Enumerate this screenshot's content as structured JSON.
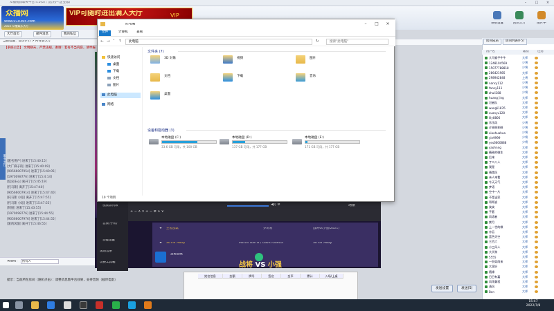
{
  "app": {
    "title": "众播视频聊天平台 4.0(0) 门店用户(企业版)",
    "logo_main": "众播网",
    "logo_url": "www.010365.com",
    "logo_sub": "2022 众播娱乐大厅",
    "vip_banner": "VIP可随时进出满人大厅",
    "vip_badge": "VIP"
  },
  "top_buttons": [
    "系统设置",
    "回到大厅",
    "图片申"
  ],
  "nav": {
    "items": [
      "大厅首页",
      "邮件消息",
      "我的私信"
    ],
    "breadcrumb": "当前位置：首页(F1)  >  所在会大厅",
    "announcement": "【系统公告】 文明聊天，严禁违规，谢谢！若有不当内容，请举报"
  },
  "side_tab": "聊天大厅",
  "chat_lines": [
    "[匿名用户]   进来了[15:40:15]",
    "[大厂麻子的]   进来了[15:40:09]",
    "[90566007954]   进来了[15:40:05]",
    "[1970098776]   进来了[15:4:14]",
    "[炫尖乐心]   离开了[15:45:19]",
    "[托马斯]   离开了[15:47:40]",
    "[90566007914]   进来了[15:47:40]",
    "[托马斯 小段]   离开了[15:47:55]",
    "[托马斯 小段]   进来了[15:47:55]",
    "[阿姐]   进来了[15:43:55]",
    "[1970098776]   进来了[15:44:55]",
    "[90566007976]   进来了[15:44:55]",
    "[爱的风旅]   离开了[15:46:55]"
  ],
  "input": {
    "label": "发送给：",
    "target": "所有人"
  },
  "status_tip": "提示：当前所在房间（随机点击）：调整消息数平台效果，支持音频（截停电影）",
  "buttons": {
    "send_settings": "发送设置",
    "send": "发送(S)"
  },
  "explorer": {
    "title": "此电脑",
    "tabs": [
      "文件",
      "计算机",
      "查看"
    ],
    "address": "此电脑",
    "search_placeholder": "搜索\"此电脑\"",
    "nav": [
      {
        "label": "快速访问",
        "sel": false
      },
      {
        "label": "桌面",
        "sel": false
      },
      {
        "label": "下载",
        "sel": false
      },
      {
        "label": "文档",
        "sel": false
      },
      {
        "label": "图片",
        "sel": false
      },
      {
        "label": "此电脑",
        "sel": true
      },
      {
        "label": "网络",
        "sel": false
      }
    ],
    "folders_header": "文件夹 (7)",
    "folders": [
      "3D 对象",
      "视频",
      "图片",
      "文档",
      "下载",
      "音乐",
      "桌面"
    ],
    "drives_header": "设备和驱动器 (3)",
    "drives": [
      {
        "name": "本地磁盘 (C:)",
        "space": "33.6 GB 可用，共 100 GB",
        "used": 0.66
      },
      {
        "name": "本地磁盘 (D:)",
        "space": "137 GB 可用，共 177 GB",
        "used": 0.23
      },
      {
        "name": "本地磁盘 (E:)",
        "space": "171 GB 可用，共 177 GB",
        "used": 0.04
      }
    ],
    "status": "10 个项目"
  },
  "stream": {
    "obs_sources": [
      "视频源列表",
      "音频(手机)",
      "功能设置",
      "现场音乐",
      "切换工具箱"
    ],
    "obs_scene": "场景",
    "songs": [
      {
        "title": "王者战歌",
        "artist": "罗莉希",
        "extra": "战将vs小强(2021)"
      },
      {
        "title": "So Far Away",
        "artist": "Martin Garrix / David Guetta",
        "extra": "So Far Away"
      }
    ],
    "vs_left": "战将",
    "vs_mid": "VS",
    "vs_right": "小强"
  },
  "sheet_headers": [
    "姓名信息",
    "金额",
    "牌号",
    "签名",
    "金币",
    "累计",
    "入场/上桌"
  ],
  "right_panel": {
    "tabs": [
      "房间成员",
      "房间列表(F5)"
    ],
    "subtab": "用户列表",
    "headers": [
      "用户名",
      "级别",
      "性别"
    ],
    "users": [
      {
        "n": "大马猴子牛牛",
        "r": "大师"
      },
      {
        "n": "1248104569",
        "r": "少将"
      },
      {
        "n": "15077788818",
        "r": "少将"
      },
      {
        "n": "286421985",
        "r": "大师"
      },
      {
        "n": "298942848",
        "r": "上将"
      },
      {
        "n": "nancy112",
        "r": "少将"
      },
      {
        "n": "fanny111",
        "r": "少将"
      },
      {
        "n": "zhuli188",
        "r": "少将"
      },
      {
        "n": "huang jing",
        "r": "大师"
      },
      {
        "n": "记者队",
        "r": "大师"
      },
      {
        "n": "wangli1876",
        "r": "大师"
      },
      {
        "n": "xuanyu128",
        "r": "大师"
      },
      {
        "n": "lily8806",
        "r": "大师"
      },
      {
        "n": "乐乐风",
        "r": "少将"
      },
      {
        "n": "ch888888",
        "r": "少将"
      },
      {
        "n": "xiaohuahua",
        "r": "少将"
      },
      {
        "n": "yie9999",
        "r": "少将"
      },
      {
        "n": "yes6600888",
        "r": "少将"
      },
      {
        "n": "yaohnng",
        "r": "大师"
      },
      {
        "n": "精致的微生",
        "r": "大师"
      },
      {
        "n": "后来",
        "r": "大师"
      },
      {
        "n": "丁二八人",
        "r": "大师"
      },
      {
        "n": "我是",
        "r": "大师"
      },
      {
        "n": "晴雪风",
        "r": "大师"
      },
      {
        "n": "亲人来看",
        "r": "大师"
      },
      {
        "n": "今天天气",
        "r": "大师"
      },
      {
        "n": "梦语",
        "r": "大师"
      },
      {
        "n": "空中一片",
        "r": "大师"
      },
      {
        "n": "不是当家",
        "r": "大师"
      },
      {
        "n": "哥哥说",
        "r": "大师"
      },
      {
        "n": "笑笑",
        "r": "大师"
      },
      {
        "n": "手套",
        "r": "大师"
      },
      {
        "n": "风语者",
        "r": "大师"
      },
      {
        "n": "紫月",
        "r": "大师"
      },
      {
        "n": "上一世的缘",
        "r": "大师"
      },
      {
        "n": "亦云",
        "r": "大师"
      },
      {
        "n": "蓝色天空",
        "r": "大师"
      },
      {
        "n": "三百六",
        "r": "大师"
      },
      {
        "n": "小三风人",
        "r": "大师"
      },
      {
        "n": "大头狗",
        "r": "大师"
      },
      {
        "n": "5555",
        "r": "大师"
      },
      {
        "n": "一别如雨来",
        "r": "大师"
      },
      {
        "n": "大家好",
        "r": "大师"
      },
      {
        "n": "随缘",
        "r": "大师"
      },
      {
        "n": "日日有嘉",
        "r": "大师"
      },
      {
        "n": "风雨兼程",
        "r": "大师"
      },
      {
        "n": "清风",
        "r": "大师"
      },
      {
        "n": "Ben",
        "r": "大师"
      }
    ]
  },
  "taskbar": {
    "time": "15:47",
    "date": "2022/7/8"
  },
  "colors": {
    "explorer_accent": "#1979ca",
    "drive_bar": "#26a0da",
    "vip_red": "#c51616",
    "taskbar": "#1f2a37"
  }
}
